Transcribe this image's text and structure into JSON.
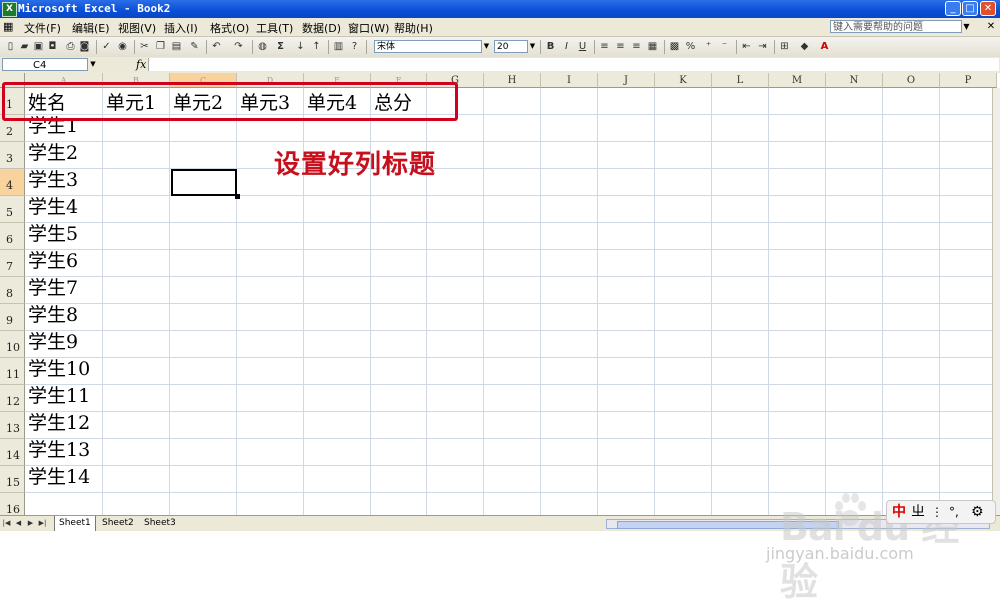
{
  "window": {
    "title": "Microsoft Excel - Book2",
    "app_icon": "X"
  },
  "menubar": {
    "items": [
      {
        "label": "文件(F)"
      },
      {
        "label": "编辑(E)"
      },
      {
        "label": "视图(V)"
      },
      {
        "label": "插入(I)"
      },
      {
        "label": "格式(O)"
      },
      {
        "label": "工具(T)"
      },
      {
        "label": "数据(D)"
      },
      {
        "label": "窗口(W)"
      },
      {
        "label": "帮助(H)"
      }
    ],
    "help_placeholder": "键入需要帮助的问题"
  },
  "toolbar": {
    "font_name": "宋体",
    "font_size": "20",
    "bold": "B",
    "italic": "I",
    "underline": "U",
    "sum": "Σ",
    "percent": "%",
    "font_color": "A",
    "icons": [
      "new-icon",
      "open-icon",
      "save-icon",
      "permission-icon",
      "print-icon",
      "print-preview-icon",
      "spelling-icon",
      "research-icon",
      "cut-icon",
      "copy-icon",
      "paste-icon",
      "format-painter-icon",
      "undo-icon",
      "redo-icon",
      "hyperlink-icon",
      "autosum-icon",
      "sort-asc-icon",
      "sort-desc-icon",
      "chart-icon",
      "help-icon"
    ]
  },
  "formula_bar": {
    "name_box": "C4",
    "fx": "fx",
    "formula": ""
  },
  "sheet": {
    "columns": [
      "A",
      "B",
      "C",
      "D",
      "E",
      "F",
      "G",
      "H",
      "I",
      "J",
      "K",
      "L",
      "M",
      "N",
      "O",
      "P"
    ],
    "selected_column": "C",
    "rows": [
      "1",
      "2",
      "3",
      "4",
      "5",
      "6",
      "7",
      "8",
      "9",
      "10",
      "11",
      "12",
      "13",
      "14",
      "15",
      "16"
    ],
    "selected_row": "4",
    "header_row": [
      "姓名",
      "单元1",
      "单元2",
      "单元3",
      "单元4",
      "总分"
    ],
    "names": [
      "学生1",
      "学生2",
      "学生3",
      "学生4",
      "学生5",
      "学生6",
      "学生7",
      "学生8",
      "学生9",
      "学生10",
      "学生11",
      "学生12",
      "学生13",
      "学生14"
    ]
  },
  "annotation": {
    "text": "设置好列标题",
    "color": "#c8101c"
  },
  "tabs": [
    {
      "label": "Sheet1",
      "active": true
    },
    {
      "label": "Sheet2",
      "active": false
    },
    {
      "label": "Sheet3",
      "active": false
    }
  ],
  "ime": {
    "glyph1": "中",
    "glyph2": "ㄓ",
    "glyph3": "°,",
    "settings_icon": "gear-icon"
  },
  "watermark": {
    "logo": "Bai du 经验",
    "url": "jingyan.baidu.com"
  },
  "colors": {
    "title_bar": "#0a4fd6",
    "selection_header": "#f9d39d",
    "callout_red": "#d3001c",
    "gridline": "#d0d7e5"
  }
}
